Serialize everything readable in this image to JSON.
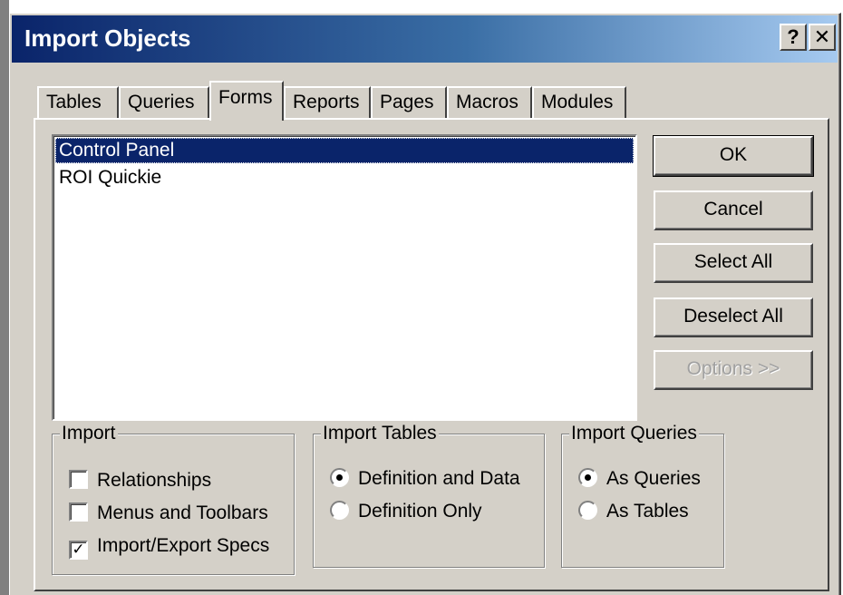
{
  "window": {
    "title": "Import Objects",
    "help_label": "?",
    "close_label": "✕"
  },
  "tabs": [
    {
      "label": "Tables"
    },
    {
      "label": "Queries"
    },
    {
      "label": "Forms",
      "active": true
    },
    {
      "label": "Reports"
    },
    {
      "label": "Pages"
    },
    {
      "label": "Macros"
    },
    {
      "label": "Modules"
    }
  ],
  "list": {
    "items": [
      {
        "label": "Control Panel",
        "selected": true
      },
      {
        "label": "ROI Quickie",
        "selected": false
      }
    ]
  },
  "buttons": {
    "ok": "OK",
    "cancel": "Cancel",
    "select_all": "Select All",
    "deselect_all": "Deselect All",
    "options": "Options >>"
  },
  "import_group": {
    "title": "Import",
    "relationships": {
      "label": "Relationships",
      "checked": false
    },
    "menus_toolbars": {
      "label": "Menus and Toolbars",
      "checked": false
    },
    "import_export_specs": {
      "label": "Import/Export Specs",
      "checked": true
    }
  },
  "import_tables_group": {
    "title": "Import Tables",
    "definition_and_data": {
      "label": "Definition and Data",
      "selected": true
    },
    "definition_only": {
      "label": "Definition Only",
      "selected": false
    }
  },
  "import_queries_group": {
    "title": "Import Queries",
    "as_queries": {
      "label": "As Queries",
      "selected": true
    },
    "as_tables": {
      "label": "As Tables",
      "selected": false
    }
  },
  "colors": {
    "face": "#d4d0c8",
    "title_gradient_start": "#0a246a",
    "title_gradient_end": "#a6caf0",
    "selection": "#0a246a"
  }
}
